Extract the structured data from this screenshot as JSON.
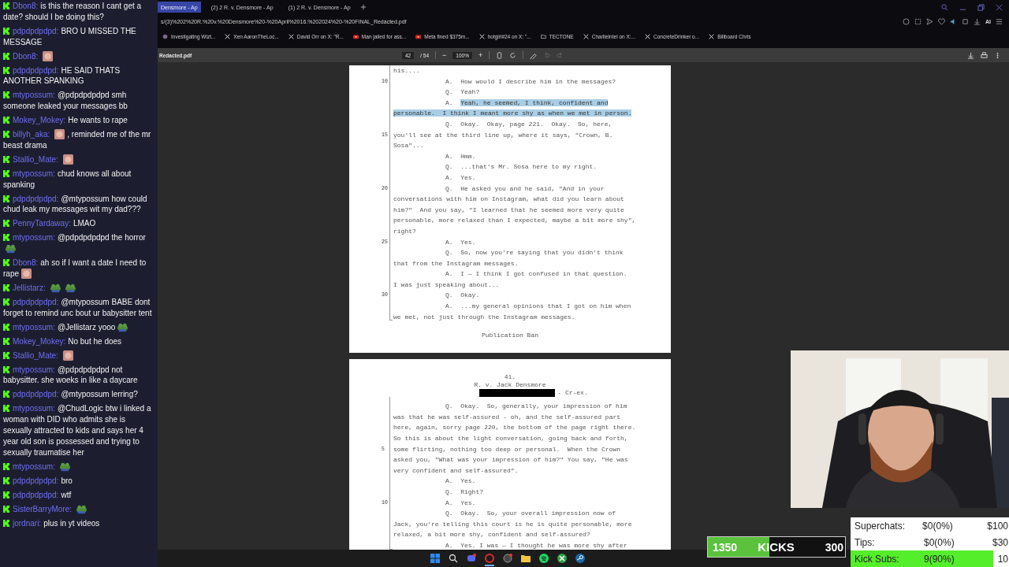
{
  "chat": {
    "messages": [
      {
        "user": "Dbon8:",
        "parts": [
          {
            "kind": "text",
            "text": "is this the reason I cant get a date? should I be doing this?"
          }
        ]
      },
      {
        "user": "pdpdpdpdpd:",
        "parts": [
          {
            "kind": "text",
            "text": "BRO U MISSED THE MESSAGE"
          }
        ]
      },
      {
        "user": "Dbon8:",
        "parts": [
          {
            "kind": "face"
          }
        ]
      },
      {
        "user": "pdpdpdpdpd:",
        "parts": [
          {
            "kind": "text",
            "text": "HE SAID THATS ANOTHER SPANKING"
          }
        ]
      },
      {
        "user": "mtypossum:",
        "parts": [
          {
            "kind": "text",
            "text": "@pdpdpdpdpd smh someone leaked your messages bb"
          }
        ]
      },
      {
        "user": "Mokey_Mokey:",
        "parts": [
          {
            "kind": "text",
            "text": "He wants to rape"
          }
        ]
      },
      {
        "user": "billyh_aka:",
        "parts": [
          {
            "kind": "face"
          },
          {
            "kind": "text",
            "text": ", reminded me of the mr beast drama"
          }
        ]
      },
      {
        "user": "Stallio_Mate:",
        "parts": [
          {
            "kind": "face"
          }
        ]
      },
      {
        "user": "mtypossum:",
        "parts": [
          {
            "kind": "text",
            "text": "chud knows all about spanking"
          }
        ]
      },
      {
        "user": "pdpdpdpdpd:",
        "parts": [
          {
            "kind": "text",
            "text": "@mtypossum how could chud leak my messages wit my dad???"
          }
        ]
      },
      {
        "user": "PennyTardaway:",
        "parts": [
          {
            "kind": "text",
            "text": "LMAO"
          }
        ]
      },
      {
        "user": "mtypossum:",
        "parts": [
          {
            "kind": "text",
            "text": "@pdpdpdpdpd the horror"
          },
          {
            "kind": "frog"
          }
        ]
      },
      {
        "user": "Dbon8:",
        "parts": [
          {
            "kind": "text",
            "text": "ah so if I want a date I need to rape"
          },
          {
            "kind": "face"
          }
        ]
      },
      {
        "user": "Jellistarz:",
        "parts": [
          {
            "kind": "frog"
          },
          {
            "kind": "frog"
          }
        ]
      },
      {
        "user": "pdpdpdpdpd:",
        "parts": [
          {
            "kind": "text",
            "text": "@mtypossum BABE dont forget to remind unc bout ur babysitter tent"
          }
        ]
      },
      {
        "user": "mtypossum:",
        "parts": [
          {
            "kind": "text",
            "text": "@Jellistarz yooo"
          },
          {
            "kind": "frog"
          }
        ]
      },
      {
        "user": "Mokey_Mokey:",
        "parts": [
          {
            "kind": "text",
            "text": "No but he does"
          }
        ]
      },
      {
        "user": "Stallio_Mate:",
        "parts": [
          {
            "kind": "face"
          }
        ]
      },
      {
        "user": "mtypossum:",
        "parts": [
          {
            "kind": "text",
            "text": "@pdpdpdpdpd not babysitter. she woeks in like a daycare"
          }
        ]
      },
      {
        "user": "pdpdpdpdpd:",
        "parts": [
          {
            "kind": "text",
            "text": "@mtypossum lerring?"
          }
        ]
      },
      {
        "user": "mtypossum:",
        "parts": [
          {
            "kind": "text",
            "text": "@ChudLogic btw i linked a woman with DID who admits she is sexually attracted to kids and says her 4 year old son is possessed and trying to sexually traumatise her"
          }
        ]
      },
      {
        "user": "mtypossum:",
        "parts": [
          {
            "kind": "frog"
          }
        ]
      },
      {
        "user": "pdpdpdpdpd:",
        "parts": [
          {
            "kind": "text",
            "text": "bro"
          }
        ]
      },
      {
        "user": "pdpdpdpdpd:",
        "parts": [
          {
            "kind": "text",
            "text": "wtf"
          }
        ]
      },
      {
        "user": "SisterBarryMore:",
        "parts": [
          {
            "kind": "frog"
          }
        ]
      },
      {
        "user": "jordnari:",
        "parts": [
          {
            "kind": "text",
            "text": "plus in yt videos"
          }
        ]
      }
    ]
  },
  "browser": {
    "tabs": [
      {
        "title": "Densmore - Ap",
        "selected": true
      },
      {
        "title": "(2) 2 R. v. Densmore - Ap",
        "selected": false
      },
      {
        "title": "(1) 2 R. v. Densmore - Ap",
        "selected": false
      }
    ],
    "url": "s/(3)%202%20R.%20v.%20Densmore%20-%20April%2016.%202024%20-%20FINAL_Redacted.pdf",
    "bookmarks": [
      {
        "kind": "generic",
        "label": "Investigating Wizt..."
      },
      {
        "kind": "x",
        "label": "Xen AaronTheLoc..."
      },
      {
        "kind": "x",
        "label": "David Orr on X: \"R..."
      },
      {
        "kind": "video",
        "label": "Man jailed for ass..."
      },
      {
        "kind": "video",
        "label": "Meta fined $375m..."
      },
      {
        "kind": "x",
        "label": "hotgirl#24 on X: \"..."
      },
      {
        "kind": "folder",
        "label": "TECTONE"
      },
      {
        "kind": "x",
        "label": "CharlieIntel on X:..."
      },
      {
        "kind": "x",
        "label": "ConcreteDrinker o..."
      },
      {
        "kind": "x",
        "label": "Billboard Chris"
      }
    ],
    "ai_label": "AI"
  },
  "pdf": {
    "filename": "Redacted.pdf",
    "page": "42",
    "page_count": "/ 54",
    "zoom_out": "−",
    "zoom": "100%",
    "zoom_in": "+",
    "pages": [
      {
        "lines": [
          {
            "highlighted": false,
            "text": "his...."
          },
          {
            "number": "10",
            "speaker": "A.",
            "highlighted": false,
            "text": "How would I describe him in the messages?"
          },
          {
            "speaker": "Q.",
            "highlighted": false,
            "text": "Yeah?"
          },
          {
            "speaker": "A.",
            "highlighted": true,
            "text": "Yeah, he seemed, I think, confident and"
          },
          {
            "highlighted": true,
            "text": "personable.  I think I meant more shy as when we met in person."
          },
          {
            "speaker": "Q.",
            "highlighted": false,
            "text": "Okay.  Okay, page 221.  Okay.  So, here,"
          },
          {
            "number": "15",
            "highlighted": false,
            "text": "you'll see at the third line up, where it says, \"Crown, B."
          },
          {
            "highlighted": false,
            "text": "Sosa\"..."
          },
          {
            "speaker": "A.",
            "highlighted": false,
            "text": "Hmm."
          },
          {
            "speaker": "Q.",
            "highlighted": false,
            "text": "...that's Mr. Sosa here to my right."
          },
          {
            "speaker": "A.",
            "highlighted": false,
            "text": "Yes."
          },
          {
            "number": "20",
            "speaker": "Q.",
            "highlighted": false,
            "text": "He asked you and he said, \"And in your"
          },
          {
            "highlighted": false,
            "text": "conversations with him on Instagram, what did you learn about"
          },
          {
            "highlighted": false,
            "text": "him?\"  And you say, \"I learned that he seemed more very quite"
          },
          {
            "highlighted": false,
            "text": "personable, more relaxed than I expected, maybe a bit more shy\","
          },
          {
            "highlighted": false,
            "text": "right?"
          },
          {
            "number": "25",
            "speaker": "A.",
            "highlighted": false,
            "text": "Yes."
          },
          {
            "speaker": "Q.",
            "highlighted": false,
            "text": "So, now you're saying that you didn't think"
          },
          {
            "highlighted": false,
            "text": "that from the Instagram messages."
          },
          {
            "speaker": "A.",
            "highlighted": false,
            "text": "I — I think I got confused in that question."
          },
          {
            "highlighted": false,
            "text": "I was just speaking about..."
          },
          {
            "number": "30",
            "speaker": "Q.",
            "highlighted": false,
            "text": "Okay."
          },
          {
            "speaker": "A.",
            "highlighted": false,
            "text": "...my general opinions that I got on him when"
          },
          {
            "highlighted": false,
            "text": "we met, not just through the Instagram messages."
          }
        ],
        "footer": "Publication Ban"
      },
      {
        "header": [
          {
            "kind": "plain",
            "text": "41."
          },
          {
            "kind": "plain",
            "text": "R. v. Jack Densmore"
          },
          {
            "kind": "redacted",
            "text": "- Cr-ex."
          }
        ],
        "lines": [
          {
            "speaker": "Q.",
            "highlighted": false,
            "text": "Okay.  So, generally, your impression of him"
          },
          {
            "highlighted": false,
            "text": "was that he was self-assured - oh, and the self-assured part"
          },
          {
            "highlighted": false,
            "text": "here, again, sorry page 220, the bottom of the page right there."
          },
          {
            "highlighted": false,
            "text": "So this is about the light conversation, going back and forth,"
          },
          {
            "number": "5",
            "highlighted": false,
            "text": "some flirting, nothing too deep or personal.  When the Crown"
          },
          {
            "highlighted": false,
            "text": "asked you, \"What was your impression of him?\" You say, \"He was"
          },
          {
            "highlighted": false,
            "text": "very confident and self-assured\"."
          },
          {
            "speaker": "A.",
            "highlighted": false,
            "text": "Yes."
          },
          {
            "speaker": "Q.",
            "highlighted": false,
            "text": "Right?"
          },
          {
            "number": "10",
            "speaker": "A.",
            "highlighted": false,
            "text": "Yes."
          },
          {
            "speaker": "Q.",
            "highlighted": false,
            "text": "Okay.  So, your overall impression now of"
          },
          {
            "highlighted": false,
            "text": "Jack, you're telling this court is he is quite personable, more"
          },
          {
            "highlighted": false,
            "text": "relaxed, a bit more shy, confident and self-assured?"
          },
          {
            "speaker": "A.",
            "highlighted": false,
            "text": "Yes. I was — I thought he was more shy after"
          }
        ]
      }
    ]
  },
  "overlay": {
    "kicks": {
      "current": "1350",
      "label": "KICKS",
      "goal": "300",
      "level": 0.45
    },
    "goals": [
      {
        "label": "Superchats:",
        "progress": "$0(0%)",
        "target": "$100",
        "level": 0
      },
      {
        "label": "Tips:",
        "progress": "$0(0%)",
        "target": "$30",
        "level": 0
      },
      {
        "label": "Kick Subs:",
        "progress": "9(90%)",
        "target": "10",
        "level": 0.9
      }
    ]
  },
  "taskbar": {
    "apps": [
      {
        "kind": "windows",
        "selected": false
      },
      {
        "kind": "search",
        "selected": false
      },
      {
        "kind": "chat",
        "selected": false
      },
      {
        "kind": "browser",
        "selected": true
      },
      {
        "kind": "browser2",
        "selected": false
      },
      {
        "kind": "folder",
        "selected": false
      },
      {
        "kind": "music",
        "selected": false
      },
      {
        "kind": "game",
        "selected": false
      },
      {
        "kind": "steam",
        "selected": false
      }
    ]
  }
}
